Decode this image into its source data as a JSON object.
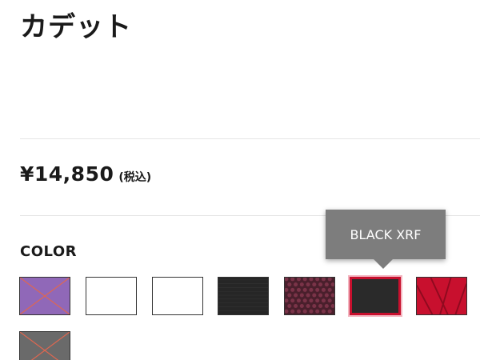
{
  "product": {
    "title": "カデット",
    "price": "¥14,850",
    "tax_note": "(税込)"
  },
  "color_section": {
    "label": "COLOR",
    "tooltip": "BLACK XRF",
    "selected_index": 5,
    "swatches": [
      {
        "fill": "#9068b8",
        "crossed": true,
        "pattern": "solid"
      },
      {
        "fill": "#ffffff",
        "crossed": false,
        "pattern": "solid"
      },
      {
        "fill": "#ffffff",
        "crossed": false,
        "pattern": "solid"
      },
      {
        "fill": "#262626",
        "crossed": false,
        "pattern": "fine-texture"
      },
      {
        "fill": "#4a1f2c",
        "crossed": false,
        "pattern": "dot-texture"
      },
      {
        "fill": "#2a2a2a",
        "crossed": false,
        "pattern": "solid"
      },
      {
        "fill": "#c8102e",
        "crossed": false,
        "pattern": "diagonal-texture"
      },
      {
        "fill": "#6a6a6a",
        "crossed": true,
        "pattern": "solid"
      }
    ]
  },
  "colors": {
    "cross_line": "#e0674f",
    "selected_border": "#c8102e",
    "tooltip_bg": "#7d7d7d"
  }
}
